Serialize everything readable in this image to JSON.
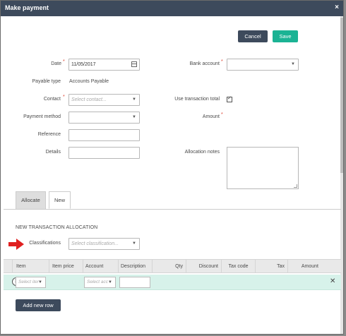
{
  "dialog": {
    "title": "Make payment",
    "close": "×"
  },
  "toolbar": {
    "cancel_label": "Cancel",
    "save_label": "Save"
  },
  "form": {
    "date_label": "Date",
    "date_value": "11/05/2017",
    "payable_type_label": "Payable type",
    "payable_type_value": "Accounts Payable",
    "contact_label": "Contact",
    "contact_placeholder": "Select contact...",
    "payment_method_label": "Payment method",
    "payment_method_value": "",
    "reference_label": "Reference",
    "reference_value": "",
    "details_label": "Details",
    "details_value": "",
    "bank_account_label": "Bank account",
    "bank_account_value": "",
    "use_transaction_total_label": "Use transaction total",
    "use_transaction_total_checked": true,
    "amount_label": "Amount",
    "allocation_notes_label": "Allocation notes",
    "required_mark": "*"
  },
  "tabs": [
    {
      "label": "Allocate",
      "active": false
    },
    {
      "label": "New",
      "active": true
    }
  ],
  "allocation": {
    "section_title": "NEW TRANSACTION ALLOCATION",
    "classifications_label": "Classifications",
    "classifications_placeholder": "Select classification...",
    "columns": [
      "Item",
      "Item price",
      "Account",
      "Description",
      "Qty",
      "Discount",
      "Tax code",
      "Tax",
      "Amount"
    ],
    "row": {
      "item_placeholder": "Select iter",
      "account_placeholder": "Select acc"
    },
    "add_row_label": "Add new row"
  },
  "icons": {
    "close": "close-icon",
    "calendar": "calendar-icon",
    "caret": "chevron-down-icon",
    "drag": "drag-handle-icon",
    "row_remove": "remove-row-icon",
    "arrow": "red-arrow-icon"
  },
  "colors": {
    "titlebar": "#3d4a5c",
    "save": "#1bb394",
    "row_highlight": "#d7f2ea",
    "arrow": "#e02020"
  }
}
